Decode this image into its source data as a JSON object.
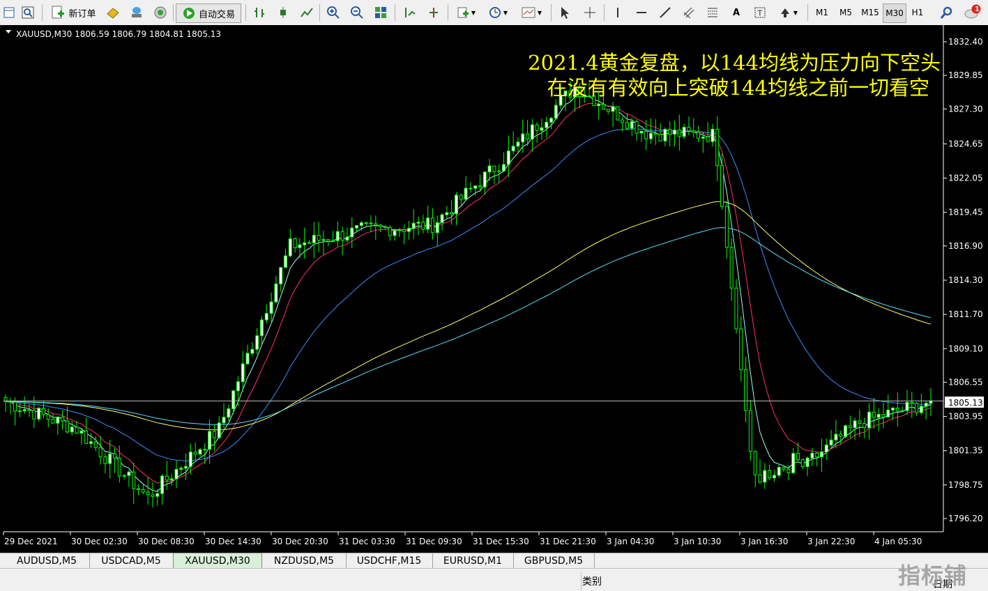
{
  "toolbar": {
    "new_order_label": "新订单",
    "auto_trading_label": "自动交易",
    "timeframes": [
      "M1",
      "M5",
      "M15",
      "M30",
      "H1"
    ],
    "active_timeframe": "M30",
    "notification_count": "1"
  },
  "chart": {
    "info_line": "XAUUSD,M30  1806.59 1806.79 1804.81 1805.13",
    "annotation_line1": "2021.4黄金复盘，以144均线为压力向下空头",
    "annotation_line2": "在没有有效向上突破144均线之前一切看空",
    "current_price_label": "1805.13",
    "price_ticks": [
      "1832.40",
      "1829.85",
      "1827.30",
      "1824.65",
      "1822.05",
      "1819.45",
      "1816.90",
      "1814.30",
      "1811.70",
      "1809.10",
      "1806.55",
      "1803.95",
      "1801.35",
      "1798.75",
      "1796.20"
    ],
    "time_labels": [
      "29 Dec 2021",
      "30 Dec 02:30",
      "30 Dec 08:30",
      "30 Dec 14:30",
      "30 Dec 20:30",
      "31 Dec 03:30",
      "31 Dec 09:30",
      "31 Dec 15:30",
      "31 Dec 21:30",
      "3 Jan 04:30",
      "3 Jan 10:30",
      "3 Jan 16:30",
      "3 Jan 22:30",
      "4 Jan 05:30"
    ],
    "colors": {
      "background": "#000000",
      "bull_candle": "#ffffff",
      "bear_candle": "#000000",
      "candle_outline": "#00ff00",
      "ma_fast": "#ff3366",
      "ma_mid": "#3a8fff",
      "ma_slow_1": "#ffff66",
      "ma_slow_2": "#55e0ff",
      "ma_short": "#9ffff0",
      "annotation": "#ffff00",
      "axis_text": "#ffffff",
      "price_line": "#c0c0c0"
    }
  },
  "chart_data": {
    "type": "candlestick",
    "symbol": "XAUUSD",
    "timeframe": "M30",
    "ylim": [
      1796.2,
      1832.4
    ],
    "open": 1806.59,
    "high": 1806.79,
    "low": 1804.81,
    "close": 1805.13,
    "approx_close_path": [
      {
        "t": "29 Dec 2021",
        "close": 1805.1
      },
      {
        "t": "30 Dec 02:30",
        "close": 1803.0
      },
      {
        "t": "30 Dec 08:30",
        "close": 1797.8
      },
      {
        "t": "30 Dec 14:30",
        "close": 1803.0
      },
      {
        "t": "30 Dec 20:30",
        "close": 1816.9
      },
      {
        "t": "31 Dec 03:30",
        "close": 1818.1
      },
      {
        "t": "31 Dec 09:30",
        "close": 1818.5
      },
      {
        "t": "31 Dec 15:30",
        "close": 1823.5
      },
      {
        "t": "31 Dec 21:30",
        "close": 1829.0
      },
      {
        "t": "3 Jan 04:30",
        "close": 1825.5
      },
      {
        "t": "3 Jan 10:30",
        "close": 1825.3
      },
      {
        "t": "3 Jan 16:30",
        "close": 1799.3
      },
      {
        "t": "3 Jan 22:30",
        "close": 1803.5
      },
      {
        "t": "4 Jan 05:30",
        "close": 1805.1
      }
    ]
  },
  "tabs": [
    "AUDUSD,M5",
    "USDCAD,M5",
    "XAUUSD,M30",
    "NZDUSD,M5",
    "USDCHF,M15",
    "EURUSD,M1",
    "GBPUSD,M5"
  ],
  "active_tab": "XAUUSD,M30",
  "bottom_panel": {
    "col_category": "类别",
    "col_date": "日期"
  },
  "watermark": "指标铺"
}
